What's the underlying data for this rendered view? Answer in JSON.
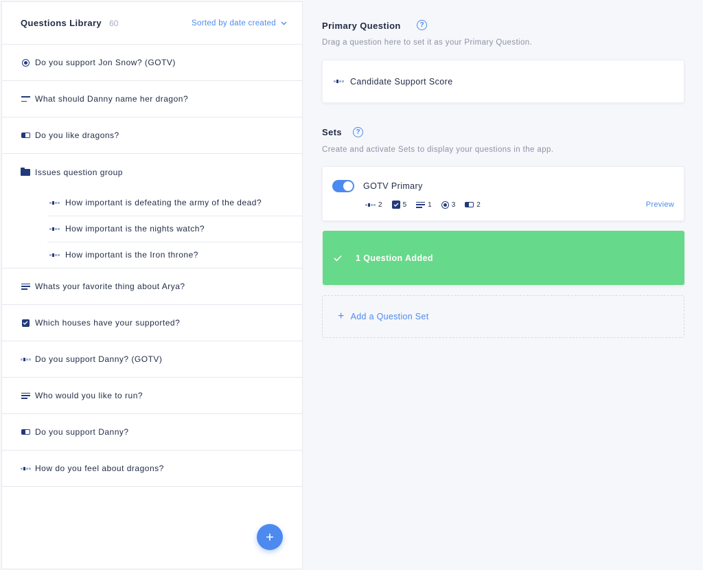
{
  "library": {
    "title": "Questions Library",
    "count": "60",
    "sort_label": "Sorted by date created",
    "items": [
      {
        "icon": "radio-icon",
        "label": "Do you support Jon Snow? (GOTV)"
      },
      {
        "icon": "text-icon",
        "label": "What should Danny name her dragon?"
      },
      {
        "icon": "toggle-icon",
        "label": "Do you like dragons?"
      },
      {
        "icon": "folder-icon",
        "label": "Issues question group"
      },
      {
        "icon": "text-lines-icon",
        "label": "Whats your favorite thing about Arya?"
      },
      {
        "icon": "checkbox-icon",
        "label": "Which houses have your supported?"
      },
      {
        "icon": "scale-icon",
        "label": "Do you support Danny? (GOTV)"
      },
      {
        "icon": "text-lines-icon",
        "label": "Who would you like to run?"
      },
      {
        "icon": "toggle-icon",
        "label": "Do you support Danny?"
      },
      {
        "icon": "scale-icon",
        "label": "How do you feel about dragons?"
      }
    ],
    "group_items": [
      {
        "icon": "scale-icon",
        "label": "How important is defeating the army of the dead?"
      },
      {
        "icon": "scale-icon",
        "label": "How important is the nights watch?"
      },
      {
        "icon": "scale-icon",
        "label": "How important is the Iron throne?"
      }
    ]
  },
  "primary": {
    "title": "Primary Question",
    "help": "?",
    "description": "Drag a question here to set it as your Primary Question.",
    "question": "Candidate Support Score"
  },
  "sets": {
    "title": "Sets",
    "help": "?",
    "description": "Create and activate Sets to display your questions in the app.",
    "set_name": "GOTV Primary",
    "set_active": true,
    "stats": [
      {
        "icon": "scale-icon",
        "count": "2"
      },
      {
        "icon": "checkbox-icon",
        "count": "5"
      },
      {
        "icon": "text-lines-icon",
        "count": "1"
      },
      {
        "icon": "radio-icon",
        "count": "3"
      },
      {
        "icon": "toggle-icon",
        "count": "2"
      }
    ],
    "preview_label": "Preview",
    "toast": "1 Question Added",
    "add_label": "Add a Question Set"
  },
  "colors": {
    "accent": "#4d8af0",
    "navy": "#233a7a",
    "success": "#67d98a"
  }
}
